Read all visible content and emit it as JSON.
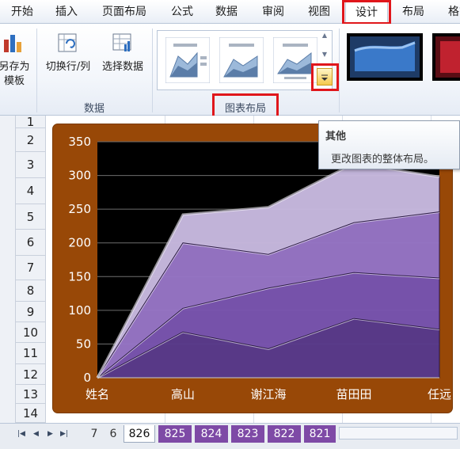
{
  "ribbon": {
    "tabs": [
      {
        "label": "开始"
      },
      {
        "label": "插入"
      },
      {
        "label": "页面布局"
      },
      {
        "label": "公式"
      },
      {
        "label": "数据"
      },
      {
        "label": "审阅"
      },
      {
        "label": "视图"
      },
      {
        "label": "设计"
      },
      {
        "label": "布局"
      },
      {
        "label": "格式"
      }
    ],
    "active_tab": "设计",
    "buttons": {
      "save_template_line1": "另存为",
      "save_template_line2": "模板",
      "switch_row_col": "切换行/列",
      "select_data": "选择数据"
    },
    "groups": {
      "data": "数据",
      "chart_layout": "图表布局"
    },
    "highlight_color": "#e0161b"
  },
  "tooltip": {
    "title": "其他",
    "description": "更改图表的整体布局。"
  },
  "sheet": {
    "rows": [
      "1",
      "2",
      "3",
      "4",
      "5",
      "6",
      "7",
      "8",
      "9",
      "10",
      "11",
      "12",
      "13",
      "14"
    ]
  },
  "chart_data": {
    "type": "area",
    "stacked": true,
    "categories": [
      "姓名",
      "高山",
      "谢江海",
      "苗田田",
      "任远"
    ],
    "series": [
      {
        "values": [
          0,
          68,
          43,
          88,
          72
        ],
        "color": "#5b3b8c"
      },
      {
        "values": [
          0,
          35,
          90,
          68,
          76
        ],
        "color": "#7a55b0"
      },
      {
        "values": [
          0,
          97,
          50,
          74,
          98
        ],
        "color": "#9775c6"
      },
      {
        "values": [
          0,
          42,
          70,
          88,
          52
        ],
        "color": "#c8b9df"
      }
    ],
    "ylim": [
      0,
      350
    ],
    "yticks": [
      "0",
      "50",
      "100",
      "150",
      "200",
      "250",
      "300",
      "350"
    ],
    "grid": true,
    "plot_background": "#000000",
    "chart_background": "#984807",
    "axis_label_color": "#ffffff"
  },
  "sheet_tabs": {
    "tabs": [
      {
        "label": "7"
      },
      {
        "label": "6"
      },
      {
        "label": "826"
      },
      {
        "label": "825"
      },
      {
        "label": "824"
      },
      {
        "label": "823"
      },
      {
        "label": "822"
      },
      {
        "label": "821"
      }
    ],
    "active": "826",
    "purple_color": "#7e4aa6"
  }
}
